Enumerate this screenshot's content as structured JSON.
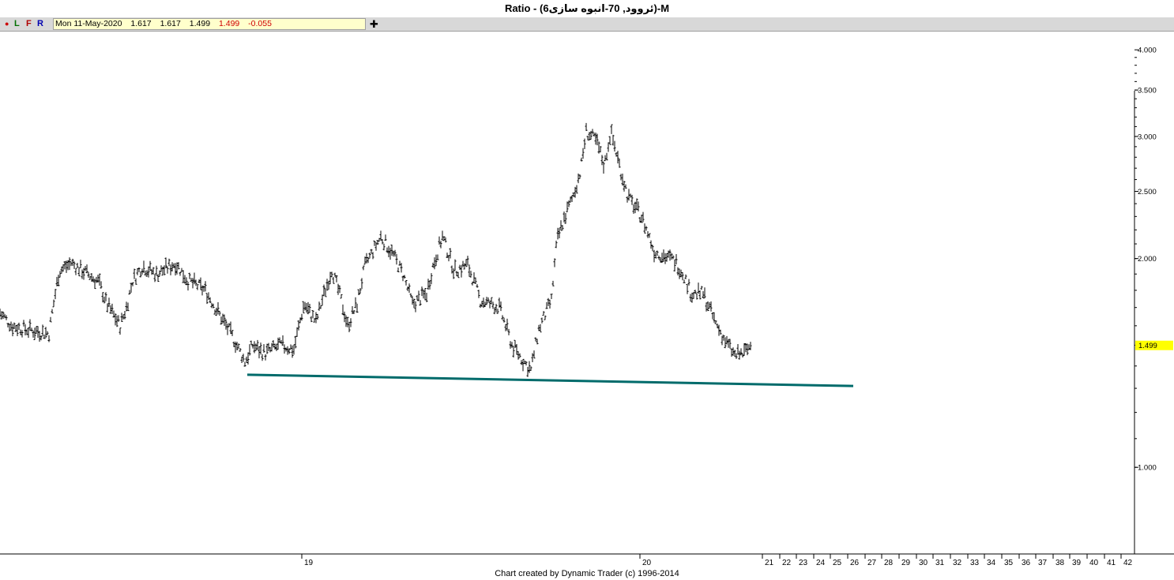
{
  "title": "Ratio - (6ئروود, 70-انبوه سازی)-M",
  "toolbar": {
    "dot": "●",
    "l": "L",
    "f": "F",
    "r": "R",
    "plus": "✚",
    "info": {
      "date": "Mon 11-May-2020",
      "open": "1.617",
      "high": "1.617",
      "low": "1.499",
      "close": "1.499",
      "change": "-0.055"
    }
  },
  "footer": "Chart created by Dynamic Trader  (c) 1996-2014",
  "colors": {
    "bars": "#000000",
    "trendline": "#006b6b",
    "price_badge": "#ffff00"
  },
  "chart_data": {
    "type": "bar",
    "y_scale": "log",
    "y_range": [
      0.75,
      4.25
    ],
    "y_ticks": [
      {
        "v": 4.0,
        "label": "4.000"
      },
      {
        "v": 3.5,
        "label": "3.500"
      },
      {
        "v": 3.0,
        "label": "3.000"
      },
      {
        "v": 2.5,
        "label": "2.500"
      },
      {
        "v": 2.0,
        "label": "2.000"
      },
      {
        "v": 1.0,
        "label": "1.000"
      }
    ],
    "last_price": {
      "value": 1.499,
      "label": "1.499"
    },
    "x_range": [
      0,
      1400
    ],
    "x_ticks": [
      {
        "x": 382,
        "label": "19"
      },
      {
        "x": 810,
        "label": "20"
      },
      {
        "x": 965,
        "label": "21"
      },
      {
        "x": 987,
        "label": "22"
      },
      {
        "x": 1008,
        "label": "23"
      },
      {
        "x": 1030,
        "label": "24"
      },
      {
        "x": 1051,
        "label": "25"
      },
      {
        "x": 1073,
        "label": "26"
      },
      {
        "x": 1095,
        "label": "27"
      },
      {
        "x": 1116,
        "label": "28"
      },
      {
        "x": 1138,
        "label": "29"
      },
      {
        "x": 1160,
        "label": "30"
      },
      {
        "x": 1181,
        "label": "31"
      },
      {
        "x": 1203,
        "label": "32"
      },
      {
        "x": 1225,
        "label": "33"
      },
      {
        "x": 1246,
        "label": "34"
      },
      {
        "x": 1268,
        "label": "35"
      },
      {
        "x": 1290,
        "label": "36"
      },
      {
        "x": 1311,
        "label": "37"
      },
      {
        "x": 1333,
        "label": "38"
      },
      {
        "x": 1354,
        "label": "39"
      },
      {
        "x": 1376,
        "label": "40"
      },
      {
        "x": 1398,
        "label": "41"
      },
      {
        "x": 1419,
        "label": "42"
      }
    ],
    "price_path": [
      [
        0,
        1.67
      ],
      [
        15,
        1.6
      ],
      [
        35,
        1.58
      ],
      [
        62,
        1.56
      ],
      [
        75,
        1.92
      ],
      [
        90,
        1.97
      ],
      [
        108,
        1.91
      ],
      [
        125,
        1.85
      ],
      [
        135,
        1.72
      ],
      [
        152,
        1.6
      ],
      [
        160,
        1.7
      ],
      [
        168,
        1.86
      ],
      [
        180,
        1.95
      ],
      [
        198,
        1.9
      ],
      [
        222,
        1.97
      ],
      [
        238,
        1.86
      ],
      [
        260,
        1.8
      ],
      [
        275,
        1.68
      ],
      [
        292,
        1.56
      ],
      [
        310,
        1.42
      ],
      [
        320,
        1.5
      ],
      [
        335,
        1.46
      ],
      [
        355,
        1.5
      ],
      [
        372,
        1.48
      ],
      [
        385,
        1.72
      ],
      [
        400,
        1.62
      ],
      [
        420,
        1.93
      ],
      [
        432,
        1.74
      ],
      [
        440,
        1.6
      ],
      [
        452,
        1.72
      ],
      [
        462,
        1.95
      ],
      [
        482,
        2.15
      ],
      [
        495,
        2.05
      ],
      [
        510,
        1.9
      ],
      [
        522,
        1.72
      ],
      [
        540,
        1.78
      ],
      [
        548,
        1.95
      ],
      [
        560,
        2.15
      ],
      [
        575,
        1.92
      ],
      [
        592,
        1.96
      ],
      [
        608,
        1.74
      ],
      [
        632,
        1.7
      ],
      [
        648,
        1.5
      ],
      [
        663,
        1.42
      ],
      [
        672,
        1.38
      ],
      [
        682,
        1.58
      ],
      [
        698,
        1.74
      ],
      [
        705,
        2.12
      ],
      [
        715,
        2.3
      ],
      [
        725,
        2.45
      ],
      [
        735,
        2.68
      ],
      [
        742,
        3.05
      ],
      [
        755,
        2.95
      ],
      [
        765,
        2.72
      ],
      [
        773,
        3.05
      ],
      [
        785,
        2.7
      ],
      [
        795,
        2.45
      ],
      [
        812,
        2.3
      ],
      [
        828,
        2.05
      ],
      [
        840,
        2.02
      ],
      [
        855,
        1.98
      ],
      [
        865,
        1.9
      ],
      [
        875,
        1.78
      ],
      [
        890,
        1.78
      ],
      [
        905,
        1.62
      ],
      [
        918,
        1.52
      ],
      [
        930,
        1.45
      ],
      [
        942,
        1.46
      ],
      [
        950,
        1.5
      ]
    ],
    "trendline": {
      "from": [
        313,
        1.36
      ],
      "to": [
        1080,
        1.31
      ]
    }
  }
}
